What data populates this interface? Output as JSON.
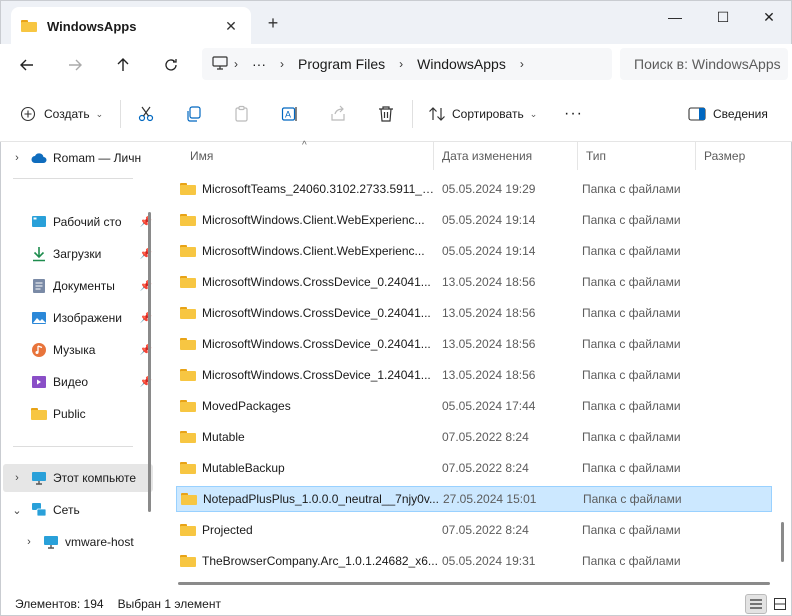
{
  "window": {
    "tab_title": "WindowsApps",
    "tab_close": "✕",
    "new_tab": "+",
    "minimize": "—",
    "maximize": "☐",
    "close": "✕"
  },
  "address": {
    "breadcrumb": [
      "Program Files",
      "WindowsApps"
    ],
    "more": "···",
    "search_placeholder": "Поиск в: WindowsApps"
  },
  "toolbar": {
    "create_label": "Создать",
    "sort_label": "Сортировать",
    "more": "···",
    "details_label": "Сведения"
  },
  "sidebar": {
    "items": [
      {
        "label": "Romam — Личн",
        "icon": "cloud-icon",
        "expand": "›"
      },
      {
        "label": "Рабочий сто",
        "icon": "desktop-icon",
        "pinned": true
      },
      {
        "label": "Загрузки",
        "icon": "download-icon",
        "pinned": true
      },
      {
        "label": "Документы",
        "icon": "documents-icon",
        "pinned": true
      },
      {
        "label": "Изображени",
        "icon": "pictures-icon",
        "pinned": true
      },
      {
        "label": "Музыка",
        "icon": "music-icon",
        "pinned": true
      },
      {
        "label": "Видео",
        "icon": "video-icon",
        "pinned": true
      },
      {
        "label": "Public",
        "icon": "folder-icon"
      },
      {
        "label": "Этот компьюте",
        "icon": "computer-icon",
        "expand": "›"
      },
      {
        "label": "Сеть",
        "icon": "network-icon",
        "expand": "⌄"
      },
      {
        "label": "vmware-host",
        "icon": "monitor-icon",
        "expand": "›"
      }
    ]
  },
  "columns": {
    "name": "Имя",
    "date": "Дата изменения",
    "type": "Тип",
    "size": "Размер"
  },
  "files": [
    {
      "name": "MicrosoftTeams_24060.3102.2733.5911_x6...",
      "date": "05.05.2024 19:29",
      "type": "Папка с файлами"
    },
    {
      "name": "MicrosoftWindows.Client.WebExperienc...",
      "date": "05.05.2024 19:14",
      "type": "Папка с файлами"
    },
    {
      "name": "MicrosoftWindows.Client.WebExperienc...",
      "date": "05.05.2024 19:14",
      "type": "Папка с файлами"
    },
    {
      "name": "MicrosoftWindows.CrossDevice_0.24041...",
      "date": "13.05.2024 18:56",
      "type": "Папка с файлами"
    },
    {
      "name": "MicrosoftWindows.CrossDevice_0.24041...",
      "date": "13.05.2024 18:56",
      "type": "Папка с файлами"
    },
    {
      "name": "MicrosoftWindows.CrossDevice_0.24041...",
      "date": "13.05.2024 18:56",
      "type": "Папка с файлами"
    },
    {
      "name": "MicrosoftWindows.CrossDevice_1.24041...",
      "date": "13.05.2024 18:56",
      "type": "Папка с файлами"
    },
    {
      "name": "MovedPackages",
      "date": "05.05.2024 17:44",
      "type": "Папка с файлами"
    },
    {
      "name": "Mutable",
      "date": "07.05.2022 8:24",
      "type": "Папка с файлами"
    },
    {
      "name": "MutableBackup",
      "date": "07.05.2022 8:24",
      "type": "Папка с файлами"
    },
    {
      "name": "NotepadPlusPlus_1.0.0.0_neutral__7njy0v...",
      "date": "27.05.2024 15:01",
      "type": "Папка с файлами",
      "selected": true
    },
    {
      "name": "Projected",
      "date": "07.05.2022 8:24",
      "type": "Папка с файлами"
    },
    {
      "name": "TheBrowserCompany.Arc_1.0.1.24682_x6...",
      "date": "05.05.2024 19:31",
      "type": "Папка с файлами"
    }
  ],
  "status": {
    "items_count": "Элементов: 194",
    "selected": "Выбран 1 элемент"
  },
  "colors": {
    "accent": "#0067c0",
    "selection": "#cce8ff",
    "folder": "#f7c642"
  }
}
